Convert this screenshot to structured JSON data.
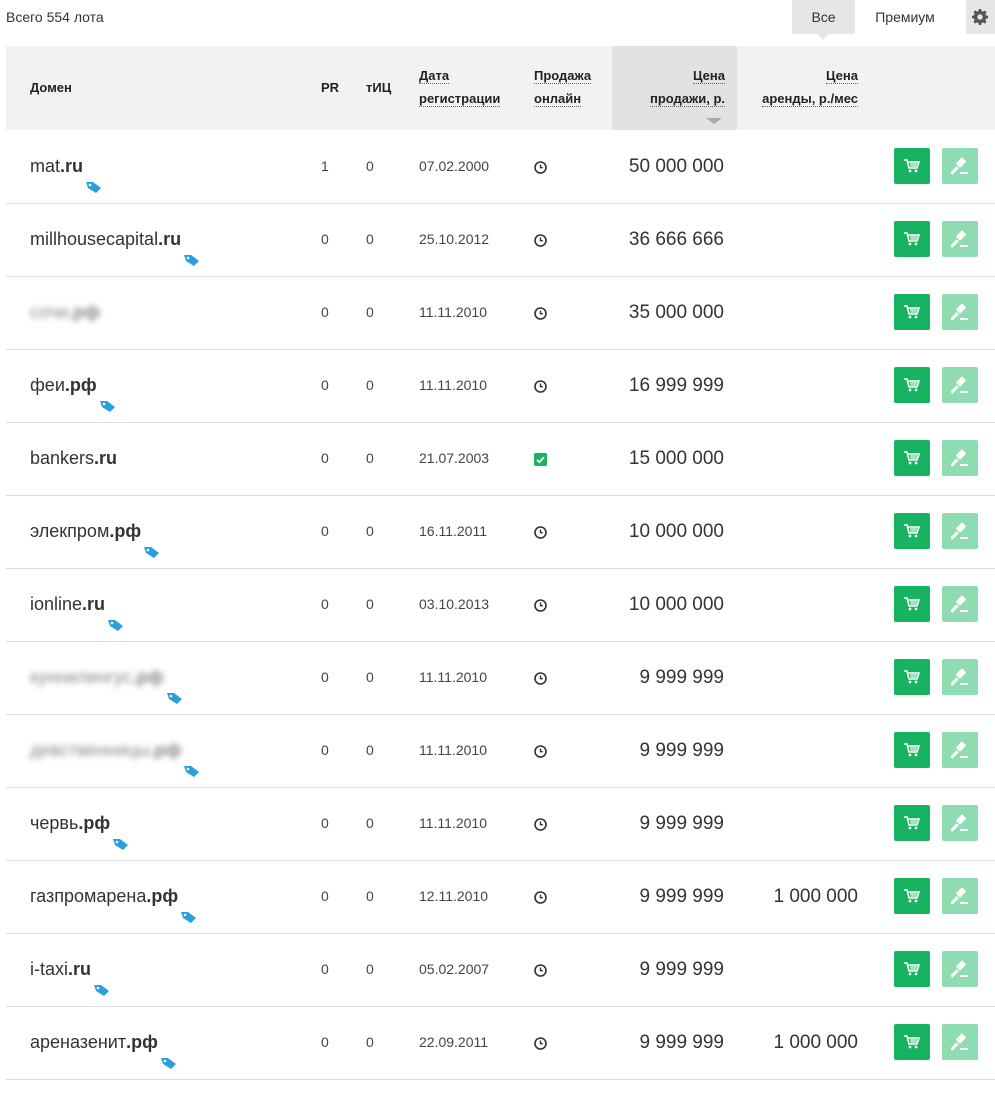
{
  "summary": {
    "total_lots": "Всего 554 лота"
  },
  "filters": {
    "all_label": "Все",
    "premium_label": "Премиум"
  },
  "header": {
    "domain": "Домен",
    "pr": "PR",
    "tic": "тИЦ",
    "reg_date_1": "Дата",
    "reg_date_2": "регистрации",
    "online_1": "Продажа",
    "online_2": "онлайн",
    "price_1": "Цена",
    "price_2": "продажи, р.",
    "rent_1": "Цена",
    "rent_2": "аренды, р./мес"
  },
  "colors": {
    "accent": "#17b360",
    "accent_light": "#8fdcb2",
    "tag": "#2a9fe0"
  },
  "rows": [
    {
      "name": "mat",
      "zone": ".ru",
      "tag": true,
      "blurred": false,
      "pr": "1",
      "tic": "0",
      "date": "07.02.2000",
      "online": "clock",
      "price": "50 000 000",
      "rent": ""
    },
    {
      "name": "millhousecapital",
      "zone": ".ru",
      "tag": true,
      "blurred": false,
      "pr": "0",
      "tic": "0",
      "date": "25.10.2012",
      "online": "clock",
      "price": "36 666 666",
      "rent": ""
    },
    {
      "name": "сочи",
      "zone": ".рф",
      "tag": false,
      "blurred": true,
      "pr": "0",
      "tic": "0",
      "date": "11.11.2010",
      "online": "clock",
      "price": "35 000 000",
      "rent": ""
    },
    {
      "name": "феи",
      "zone": ".рф",
      "tag": true,
      "blurred": false,
      "pr": "0",
      "tic": "0",
      "date": "11.11.2010",
      "online": "clock",
      "price": "16 999 999",
      "rent": ""
    },
    {
      "name": "bankers",
      "zone": ".ru",
      "tag": false,
      "blurred": false,
      "pr": "0",
      "tic": "0",
      "date": "21.07.2003",
      "online": "check",
      "price": "15 000 000",
      "rent": ""
    },
    {
      "name": "элекпром",
      "zone": ".рф",
      "tag": true,
      "blurred": false,
      "pr": "0",
      "tic": "0",
      "date": "16.11.2011",
      "online": "clock",
      "price": "10 000 000",
      "rent": ""
    },
    {
      "name": "ionline",
      "zone": ".ru",
      "tag": true,
      "blurred": false,
      "pr": "0",
      "tic": "0",
      "date": "03.10.2013",
      "online": "clock",
      "price": "10 000 000",
      "rent": ""
    },
    {
      "name": "куннилингус",
      "zone": ".рф",
      "tag": true,
      "blurred": true,
      "pr": "0",
      "tic": "0",
      "date": "11.11.2010",
      "online": "clock",
      "price": "9 999 999",
      "rent": ""
    },
    {
      "name": "девственницы",
      "zone": ".рф",
      "tag": true,
      "blurred": true,
      "pr": "0",
      "tic": "0",
      "date": "11.11.2010",
      "online": "clock",
      "price": "9 999 999",
      "rent": ""
    },
    {
      "name": "червь",
      "zone": ".рф",
      "tag": true,
      "blurred": false,
      "pr": "0",
      "tic": "0",
      "date": "11.11.2010",
      "online": "clock",
      "price": "9 999 999",
      "rent": ""
    },
    {
      "name": "газпромарена",
      "zone": ".рф",
      "tag": true,
      "blurred": false,
      "pr": "0",
      "tic": "0",
      "date": "12.11.2010",
      "online": "clock",
      "price": "9 999 999",
      "rent": "1 000 000"
    },
    {
      "name": "i-taxi",
      "zone": ".ru",
      "tag": true,
      "blurred": false,
      "pr": "0",
      "tic": "0",
      "date": "05.02.2007",
      "online": "clock",
      "price": "9 999 999",
      "rent": ""
    },
    {
      "name": "ареназенит",
      "zone": ".рф",
      "tag": true,
      "blurred": false,
      "pr": "0",
      "tic": "0",
      "date": "22.09.2011",
      "online": "clock",
      "price": "9 999 999",
      "rent": "1 000 000"
    }
  ]
}
